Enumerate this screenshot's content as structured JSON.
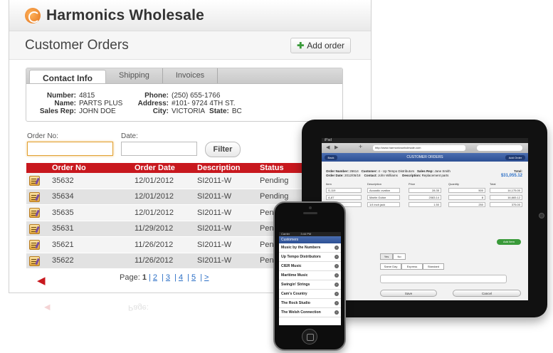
{
  "app": {
    "brand": "Harmonics Wholesale",
    "page_title": "Customer Orders",
    "add_order_label": "Add order"
  },
  "tabs": [
    "Contact Info",
    "Shipping",
    "Invoices"
  ],
  "contact": {
    "number_label": "Number:",
    "number": "4815",
    "name_label": "Name:",
    "name": "PARTS PLUS",
    "salesrep_label": "Sales Rep:",
    "salesrep": "JOHN DOE",
    "phone_label": "Phone:",
    "phone": "(250) 655-1766",
    "address_label": "Address:",
    "address": "#101- 9724 4TH ST.",
    "city_label": "City:",
    "city": "VICTORIA",
    "state_label": "State:",
    "state": "BC"
  },
  "filter": {
    "order_no_label": "Order No:",
    "date_label": "Date:",
    "filter_label": "Filter"
  },
  "table": {
    "headers": [
      "Order No",
      "Order Date",
      "Description",
      "Status"
    ],
    "rows": [
      {
        "no": "35632",
        "date": "12/01/2012",
        "desc": "SI2011-W",
        "status": "Pending"
      },
      {
        "no": "35634",
        "date": "12/01/2012",
        "desc": "SI2011-W",
        "status": "Pending"
      },
      {
        "no": "35635",
        "date": "12/01/2012",
        "desc": "SI2011-W",
        "status": "Pending"
      },
      {
        "no": "35631",
        "date": "11/29/2012",
        "desc": "SI2011-W",
        "status": "Pend"
      },
      {
        "no": "35621",
        "date": "11/26/2012",
        "desc": "SI2011-W",
        "status": "Penc"
      },
      {
        "no": "35622",
        "date": "11/26/2012",
        "desc": "SI2011-W",
        "status": "Pend"
      }
    ]
  },
  "pager": {
    "label": "Page:",
    "current": "1",
    "pages": [
      "2",
      "3",
      "4",
      "5",
      ">"
    ]
  },
  "ipad": {
    "status": "iPad",
    "url": "http://www.harmonicswholesale.com",
    "nav_title": "CUSTOMER ORDERS",
    "back": "Back",
    "add_order": "Add Order",
    "order_number_label": "Order Number:",
    "order_number": "26614",
    "order_date_label": "Order Date:",
    "order_date": "2012/05/18",
    "customer_label": "Customer:",
    "customer": "4 - Up Tempo Distributors",
    "contact_label": "Contact:",
    "contact": "John Williams",
    "salesrep_label": "Sales Rep:",
    "salesrep": "Jane Smith",
    "description_label": "Description:",
    "description": "Replacement parts",
    "total_label": "Total:",
    "total": "$31,055.12",
    "item_headers": [
      "Item",
      "Description",
      "Price",
      "Quantity",
      "Total"
    ],
    "items": [
      {
        "item": "S-119",
        "desc": "Acoustic ovation",
        "price": "28.35",
        "qty": "500",
        "total": "14,175.00"
      },
      {
        "item": "A-87",
        "desc": "Martin Guitar",
        "price": "2083.14",
        "qty": "8",
        "total": "16,665.12"
      },
      {
        "item": "",
        "desc": "1/4 inch jack",
        "price": "1.50",
        "qty": "250",
        "total": "375.00"
      }
    ],
    "add_item": "Add Item",
    "yes": "Yes",
    "no": "No",
    "ship_options": [
      "Same Day",
      "Express",
      "Standard"
    ],
    "save": "Save",
    "cancel": "Cancel"
  },
  "iphone": {
    "carrier": "Carrier",
    "time": "3:44 PM",
    "title": "Customers",
    "customers": [
      "Music by the Numbers",
      "Up Tempo Distributors",
      "CIER Music",
      "Maritime Music",
      "Swingin' Strings",
      "Cam's Country",
      "The Rock Studio",
      "The Welsh Connection"
    ]
  }
}
